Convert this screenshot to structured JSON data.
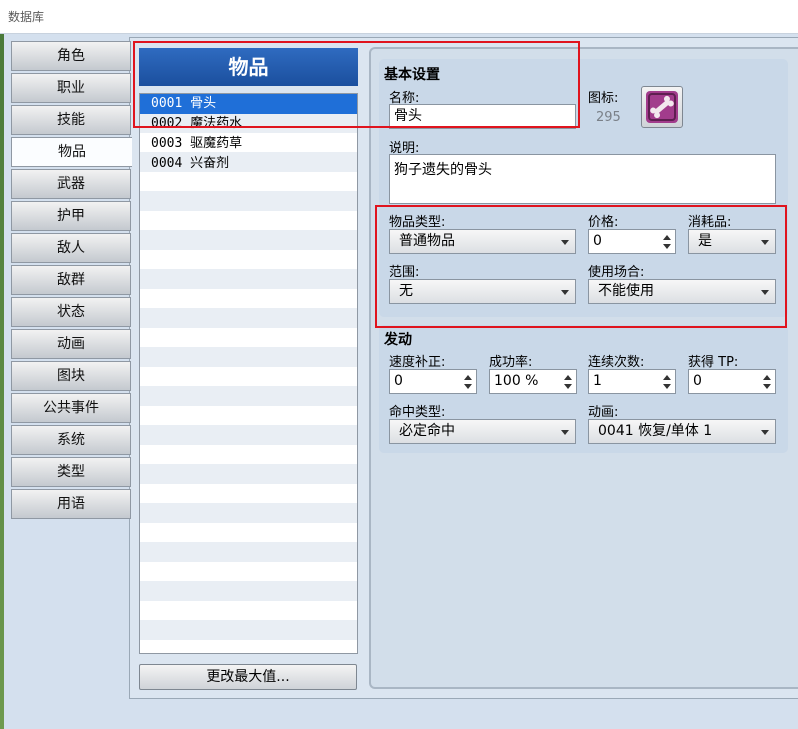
{
  "window": {
    "title": "数据库"
  },
  "tabs": [
    "角色",
    "职业",
    "技能",
    "物品",
    "武器",
    "护甲",
    "敌人",
    "敌群",
    "状态",
    "动画",
    "图块",
    "公共事件",
    "系统",
    "类型",
    "用语"
  ],
  "active_tab": "物品",
  "list": {
    "header": "物品",
    "items": [
      "0001 骨头",
      "0002 魔法药水",
      "0003 驱魔药草",
      "0004 兴奋剂"
    ],
    "selected_index": 0,
    "change_max_button": "更改最大值..."
  },
  "basic": {
    "title": "基本设置",
    "name_label": "名称:",
    "name_value": "骨头",
    "icon_label": "图标:",
    "icon_index": "295",
    "icon_name": "bone-icon",
    "desc_label": "说明:",
    "desc_value": "狗子遗失的骨头",
    "item_type_label": "物品类型:",
    "item_type_value": "普通物品",
    "price_label": "价格:",
    "price_value": "0",
    "consumable_label": "消耗品:",
    "consumable_value": "是",
    "scope_label": "范围:",
    "scope_value": "无",
    "occasion_label": "使用场合:",
    "occasion_value": "不能使用"
  },
  "invocation": {
    "title": "发动",
    "speed_label": "速度补正:",
    "speed_value": "0",
    "success_label": "成功率:",
    "success_value": "100 %",
    "repeats_label": "连续次数:",
    "repeats_value": "1",
    "tp_label": "获得 TP:",
    "tp_value": "0",
    "hit_type_label": "命中类型:",
    "hit_type_value": "必定命中",
    "animation_label": "动画:",
    "animation_value": "0041 恢复/单体 1"
  },
  "colors": {
    "accent_blue": "#1f6fd8",
    "header_blue": "#1b4f9e",
    "highlight_red": "#e0141e",
    "icon_magenta": "#a23c8c"
  }
}
